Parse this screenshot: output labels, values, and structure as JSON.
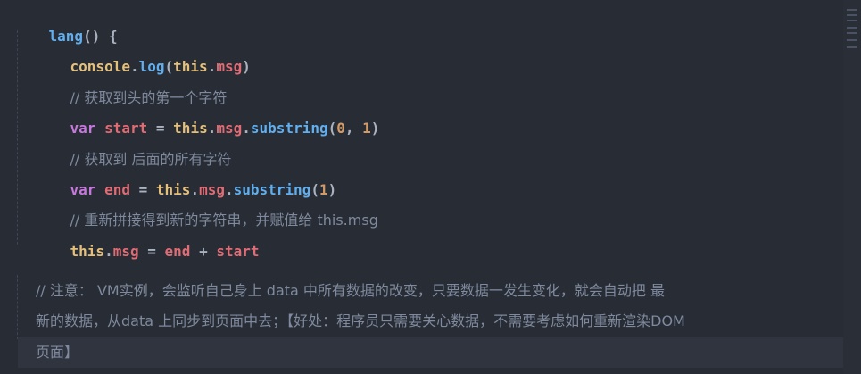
{
  "code": {
    "method_name": "lang",
    "method_sig_tail": "() {",
    "line2_obj": "console",
    "line2_dot": ".",
    "line2_fn": "log",
    "line2_open": "(",
    "line2_this": "this",
    "line2_prop": "msg",
    "line2_close": ")",
    "comment1": "// 获取到头的第一个字符",
    "var_kw": "var",
    "start_name": "start",
    "eq": "=",
    "substring": "substring",
    "args1_a": "0",
    "args1_b": "1",
    "comment2": "// 获取到 后面的所有字符",
    "end_name": "end",
    "args2": "1",
    "comment3": "// 重新拼接得到新的字符串，并赋值给 this.msg",
    "plus": "+",
    "note_line1": "// 注意： VM实例，会监听自己身上 data 中所有数据的改变，只要数据一发生变化，就会自动把 最",
    "note_line2": "新的数据，从data 上同步到页面中去；【好处：程序员只需要关心数据，不需要考虑如何重新渲染DOM",
    "note_line3": "页面】"
  }
}
